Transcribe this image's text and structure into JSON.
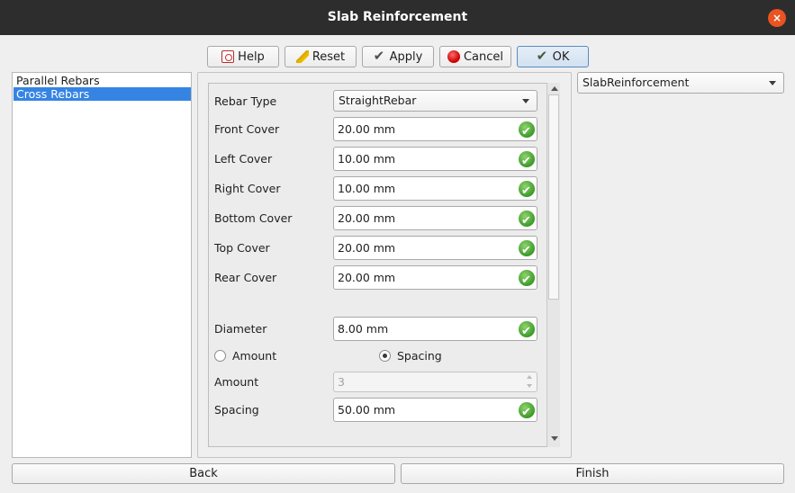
{
  "window": {
    "title": "Slab Reinforcement",
    "close_label": "×"
  },
  "toolbar": {
    "help_label": "Help",
    "reset_label": "Reset",
    "apply_label": "Apply",
    "cancel_label": "Cancel",
    "ok_label": "OK"
  },
  "left_list": {
    "items": [
      "Parallel Rebars",
      "Cross Rebars"
    ],
    "selected": "Cross Rebars"
  },
  "form": {
    "rebar_type": {
      "label": "Rebar Type",
      "value": "StraightRebar"
    },
    "front_cover": {
      "label": "Front Cover",
      "value": "20.00 mm"
    },
    "left_cover": {
      "label": "Left Cover",
      "value": "10.00 mm"
    },
    "right_cover": {
      "label": "Right Cover",
      "value": "10.00 mm"
    },
    "bottom_cover": {
      "label": "Bottom Cover",
      "value": "20.00 mm"
    },
    "top_cover": {
      "label": "Top Cover",
      "value": "20.00 mm"
    },
    "rear_cover": {
      "label": "Rear Cover",
      "value": "20.00 mm"
    },
    "diameter": {
      "label": "Diameter",
      "value": "8.00 mm"
    },
    "radio_amount": {
      "label": "Amount",
      "checked": false
    },
    "radio_spacing": {
      "label": "Spacing",
      "checked": true
    },
    "amount": {
      "label": "Amount",
      "value": "3"
    },
    "spacing": {
      "label": "Spacing",
      "value": "50.00 mm"
    }
  },
  "object_selector": {
    "value": "SlabReinforcement"
  },
  "footer": {
    "back_label": "Back",
    "finish_label": "Finish"
  },
  "colors": {
    "titlebar": "#2d2d2d",
    "selection": "#3584e4",
    "close": "#e95420",
    "valid_check": "#3d9a2a"
  }
}
